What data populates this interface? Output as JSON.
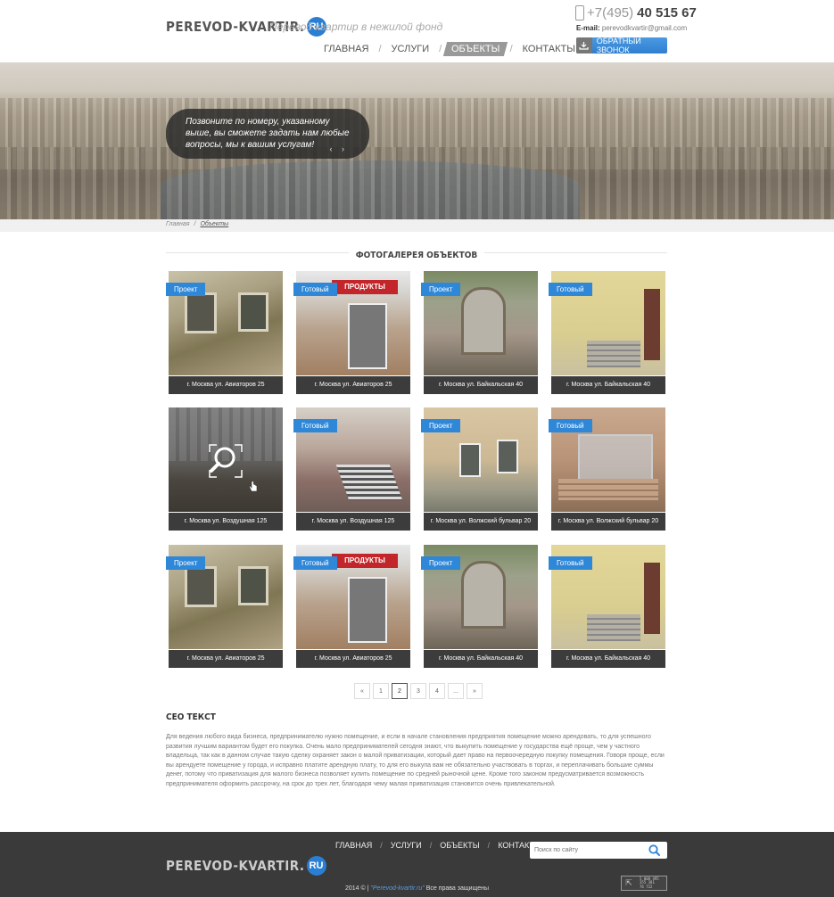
{
  "header": {
    "logo_text": "PEREVOD-KVARTIR.",
    "logo_ru": "RU",
    "slogan": "Перевод квартир в нежилой фонд",
    "nav": [
      {
        "label": "Главная",
        "active": false
      },
      {
        "label": "Услуги",
        "active": false
      },
      {
        "label": "Объекты",
        "active": true
      },
      {
        "label": "Контакты",
        "active": false
      }
    ],
    "phone_code": "+7(495)",
    "phone_number": "40 515 67",
    "email_label": "E-mail:",
    "email": "perevodkvartir@gmail.com",
    "callback_label": "Обратный звонок"
  },
  "hero": {
    "text": "Позвоните по номеру, указанному выше, вы сможете задать нам любые вопросы, мы к вашим услугам!",
    "arrows": "‹ ›"
  },
  "breadcrumb": {
    "items": [
      "Главная",
      "Объекты"
    ],
    "separator": "/"
  },
  "gallery": {
    "title": "Фотогалерея объектов",
    "cards": [
      {
        "badge": "Проект",
        "caption": "г. Москва ул. Авиаторов 25"
      },
      {
        "badge": "Готовый",
        "caption": "г. Москва ул. Авиаторов 25"
      },
      {
        "badge": "Проект",
        "caption": "г. Москва ул. Байкальская 40"
      },
      {
        "badge": "Готовый",
        "caption": "г. Москва ул. Байкальская 40"
      },
      {
        "badge": "",
        "caption": "г. Москва ул. Воздушная 125"
      },
      {
        "badge": "Готовый",
        "caption": "г. Москва ул. Воздушная 125"
      },
      {
        "badge": "Проект",
        "caption": "г. Москва ул. Волжский бульвар 20"
      },
      {
        "badge": "Готовый",
        "caption": "г. Москва ул. Волжский бульвар 20"
      },
      {
        "badge": "Проект",
        "caption": "г. Москва ул. Авиаторов 25"
      },
      {
        "badge": "Готовый",
        "caption": "г. Москва ул. Авиаторов 25"
      },
      {
        "badge": "Проект",
        "caption": "г. Москва ул. Байкальская 40"
      },
      {
        "badge": "Готовый",
        "caption": "г. Москва ул. Байкальская 40"
      }
    ]
  },
  "pagination": {
    "prev": "«",
    "pages": [
      "1",
      "2",
      "3",
      "4",
      "..."
    ],
    "next": "»",
    "current": "2"
  },
  "seo": {
    "title": "СЕО текст",
    "text": "Для ведения любого вида бизнеса, предпринимателю нужно помещение, и если в начале становления предприятия помещение можно арендовать, то для успешного развития лучшим вариантом будет его покупка. Очень мало предпринимателей сегодня знают, что выкупить помещение у государства ещё проще, чем у частного владельца, так как в данном случае такую сделку охраняет закон о малой приватизации, который дает право на первоочередную покупку помещения. Говоря проще, если вы арендуете помещение у города, и исправно платите арендную плату, то для его выкупа вам не обязательно участвовать в торгах, и переплачивать большие суммы денег, потому что приватизация для малого бизнеса позволяет купить помещение по средней рыночной цене. Кроме того законом предусматривается возможность предпринимателя оформить рассрочку, на срок до трех лет, благодаря чему малая приватизация становится очень привлекательной."
  },
  "footer": {
    "nav": [
      "Главная",
      "Услуги",
      "Объекты",
      "Контакты"
    ],
    "search_placeholder": "Поиск по сайту",
    "logo_text": "PEREVOD-KVARTIR.",
    "logo_ru": "RU",
    "copy_prefix": "2014 © |",
    "copy_site": "\"Perevod-kvartir.ru\"",
    "copy_suffix": "Все права защищены",
    "counter": [
      "5 008 495",
      "355 381",
      "76 722"
    ]
  },
  "colors": {
    "accent": "#2f87d8",
    "footer_bg": "#3a3a3a",
    "caption_bg": "#3c3c3c"
  }
}
